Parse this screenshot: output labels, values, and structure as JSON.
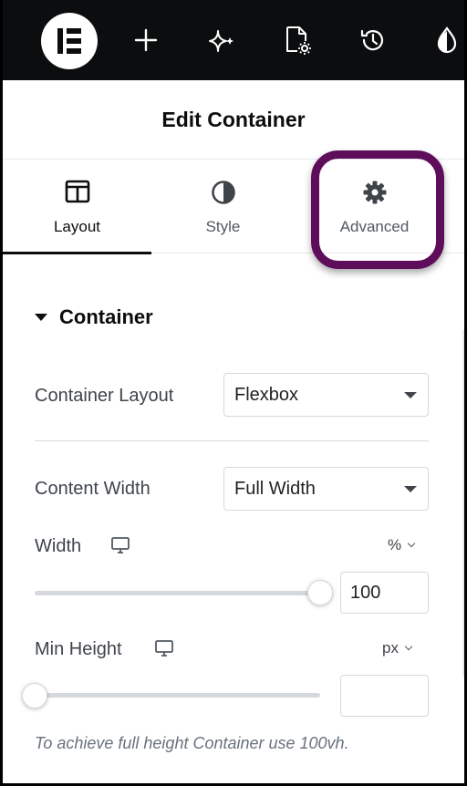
{
  "topbar": {
    "logo_icon": "elementor-logo-icon",
    "icons": [
      "plus-icon",
      "ai-sparkle-icon",
      "page-settings-icon",
      "history-icon",
      "theme-style-icon"
    ]
  },
  "header": {
    "title": "Edit Container"
  },
  "tabs": [
    {
      "label": "Layout",
      "icon": "columns-layout-icon",
      "active": true
    },
    {
      "label": "Style",
      "icon": "half-circle-icon",
      "active": false
    },
    {
      "label": "Advanced",
      "icon": "gear-icon",
      "active": false
    }
  ],
  "highlight_color": "#5e0d5b",
  "section": {
    "title": "Container"
  },
  "controls": {
    "container_layout": {
      "label": "Container Layout",
      "value": "Flexbox"
    },
    "content_width": {
      "label": "Content Width",
      "value": "Full Width"
    },
    "width": {
      "label": "Width",
      "unit": "%",
      "value": "100",
      "slider_fraction": 1.0
    },
    "min_height": {
      "label": "Min Height",
      "unit": "px",
      "value": "",
      "slider_fraction": 0.0
    }
  },
  "note": "To achieve full height Container use 100vh."
}
